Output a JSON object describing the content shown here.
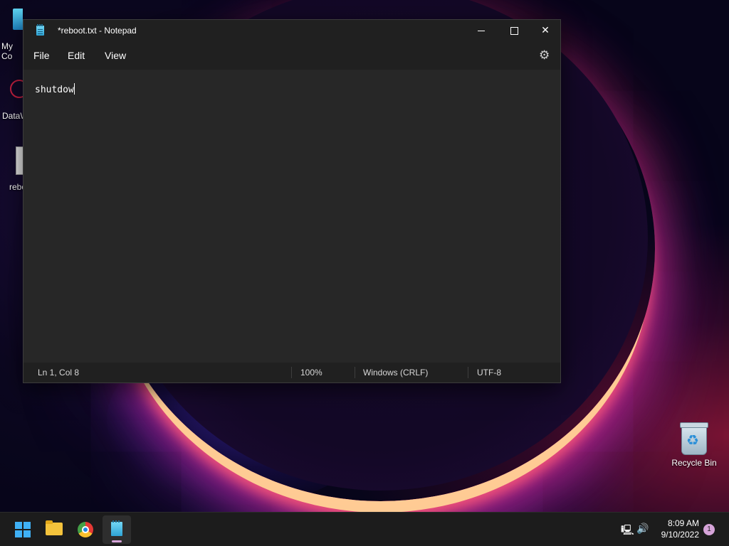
{
  "desktop": {
    "icons": [
      {
        "label": "My Co"
      },
      {
        "label": "DataW"
      },
      {
        "label": "rebo"
      },
      {
        "label": "Recycle Bin"
      }
    ]
  },
  "window": {
    "title": "*reboot.txt - Notepad",
    "controls": {
      "minimize": "minimize",
      "maximize": "maximize",
      "close": "✕"
    }
  },
  "menu": {
    "file": "File",
    "edit": "Edit",
    "view": "View"
  },
  "editor": {
    "content": "shutdow"
  },
  "status": {
    "position": "Ln 1, Col 8",
    "zoom": "100%",
    "line_ending": "Windows (CRLF)",
    "encoding": "UTF-8"
  },
  "taskbar": {
    "apps": [
      {
        "icon": "windows-start-icon"
      },
      {
        "icon": "file-explorer-icon"
      },
      {
        "icon": "chrome-icon"
      },
      {
        "icon": "notepad-icon",
        "active": true
      }
    ],
    "time": "8:09 AM",
    "date": "9/10/2022",
    "notifications": "1"
  },
  "colors": {
    "accent": "#d6a4d9",
    "window_bg": "#202020",
    "editor_bg": "#272727"
  }
}
